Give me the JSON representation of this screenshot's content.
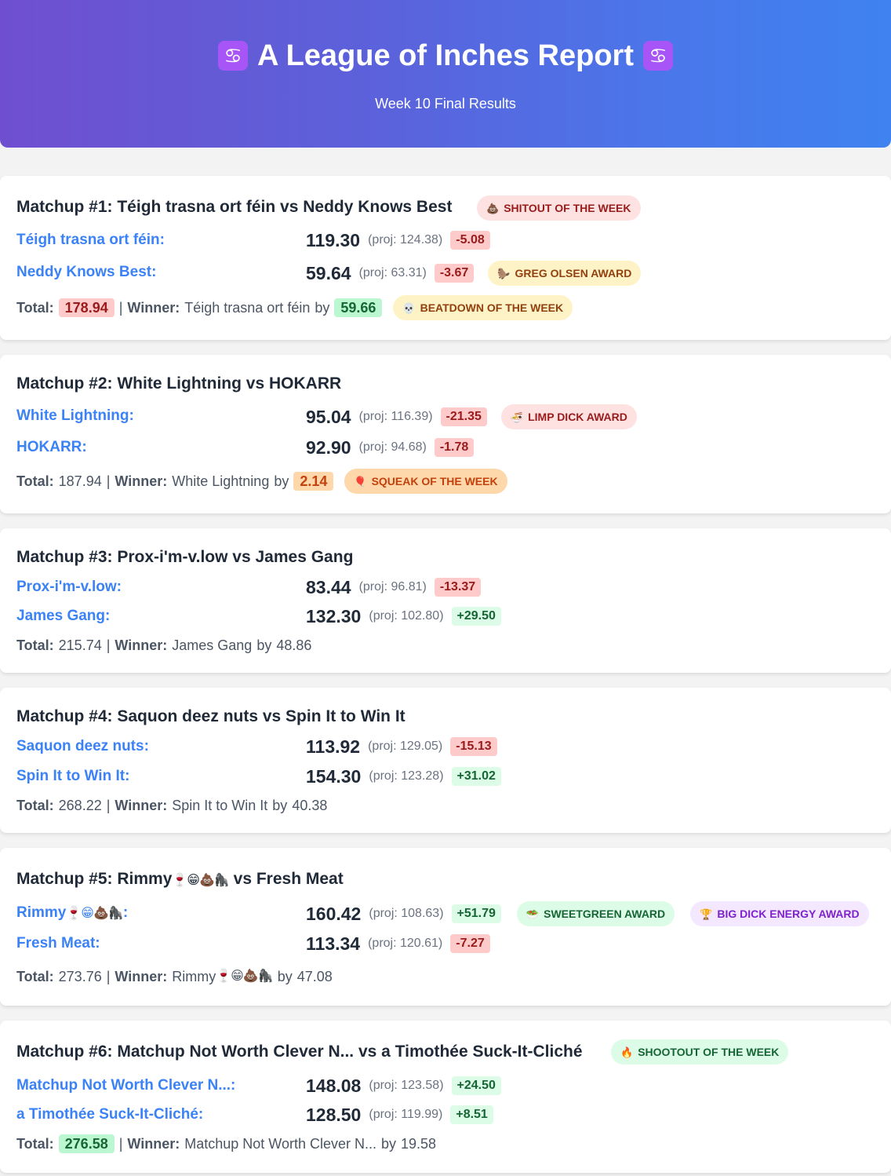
{
  "header": {
    "title": "A League of Inches Report",
    "subtitle": "Week 10 Final Results",
    "icon_left": "♋",
    "icon_right": "♋"
  },
  "labels": {
    "total": "Total:",
    "winner": "Winner:",
    "by": "by",
    "sep": "|"
  },
  "matchups": [
    {
      "title": "Matchup #1: Téigh trasna ort féin vs Neddy Knows Best",
      "title_award": {
        "icon": "💩",
        "label": "SHITOUT OF THE WEEK"
      },
      "team1": {
        "name": "Téigh trasna ort féin:",
        "score": "119.30",
        "proj": "(proj: 124.38)",
        "diff": "-5.08"
      },
      "team2": {
        "name": "Neddy Knows Best:",
        "score": "59.64",
        "proj": "(proj: 63.31)",
        "diff": "-3.67",
        "award": {
          "icon": "🦫",
          "label": "GREG OLSEN AWARD"
        }
      },
      "total": "178.94",
      "winner": "Téigh trasna ort féin",
      "margin": "59.66",
      "result_award": {
        "icon": "💀",
        "label": "BEATDOWN OF THE WEEK"
      }
    },
    {
      "title": "Matchup #2: White Lightning vs HOKARR",
      "team1": {
        "name": "White Lightning:",
        "score": "95.04",
        "proj": "(proj: 116.39)",
        "diff": "-21.35",
        "award": {
          "icon": "🍜",
          "label": "LIMP DICK AWARD"
        }
      },
      "team2": {
        "name": "HOKARR:",
        "score": "92.90",
        "proj": "(proj: 94.68)",
        "diff": "-1.78"
      },
      "total": "187.94",
      "winner": "White Lightning",
      "margin": "2.14",
      "result_award": {
        "icon": "🎈",
        "label": "SQUEAK OF THE WEEK"
      }
    },
    {
      "title": "Matchup #3: Prox-i'm-v.low vs James Gang",
      "team1": {
        "name": "Prox-i'm-v.low:",
        "score": "83.44",
        "proj": "(proj: 96.81)",
        "diff": "-13.37"
      },
      "team2": {
        "name": "James Gang:",
        "score": "132.30",
        "proj": "(proj: 102.80)",
        "diff": "+29.50"
      },
      "total": "215.74",
      "winner": "James Gang",
      "margin": "48.86"
    },
    {
      "title": "Matchup #4: Saquon deez nuts vs Spin It to Win It",
      "team1": {
        "name": "Saquon deez nuts:",
        "score": "113.92",
        "proj": "(proj: 129.05)",
        "diff": "-15.13"
      },
      "team2": {
        "name": "Spin It to Win It:",
        "score": "154.30",
        "proj": "(proj: 123.28)",
        "diff": "+31.02"
      },
      "total": "268.22",
      "winner": "Spin It to Win It",
      "margin": "40.38"
    },
    {
      "title_a": "Matchup #5: Rimmy",
      "title_b": " vs Fresh Meat",
      "emoji": "🍷😁💩🦍",
      "team1": {
        "name": "Rimmy",
        "name_suffix": ":",
        "score": "160.42",
        "proj": "(proj: 108.63)",
        "diff": "+51.79",
        "award": {
          "icon": "🥗",
          "label": "SWEETGREEN AWARD"
        },
        "award2": {
          "icon": "🏆",
          "label": "BIG DICK ENERGY AWARD"
        }
      },
      "team2": {
        "name": "Fresh Meat:",
        "score": "113.34",
        "proj": "(proj: 120.61)",
        "diff": "-7.27"
      },
      "total": "273.76",
      "winner": "Rimmy",
      "margin": "47.08"
    },
    {
      "title": "Matchup #6: Matchup Not Worth Clever N... vs a Timothée Suck-It-Cliché",
      "title_award": {
        "icon": "🔥",
        "label": "SHOOTOUT OF THE WEEK"
      },
      "team1": {
        "name": "Matchup Not Worth Clever N...:",
        "score": "148.08",
        "proj": "(proj: 123.58)",
        "diff": "+24.50"
      },
      "team2": {
        "name": "a Timothée Suck-It-Cliché:",
        "score": "128.50",
        "proj": "(proj: 119.99)",
        "diff": "+8.51"
      },
      "total": "276.58",
      "winner": "Matchup Not Worth Clever N...",
      "margin": "19.58"
    }
  ]
}
